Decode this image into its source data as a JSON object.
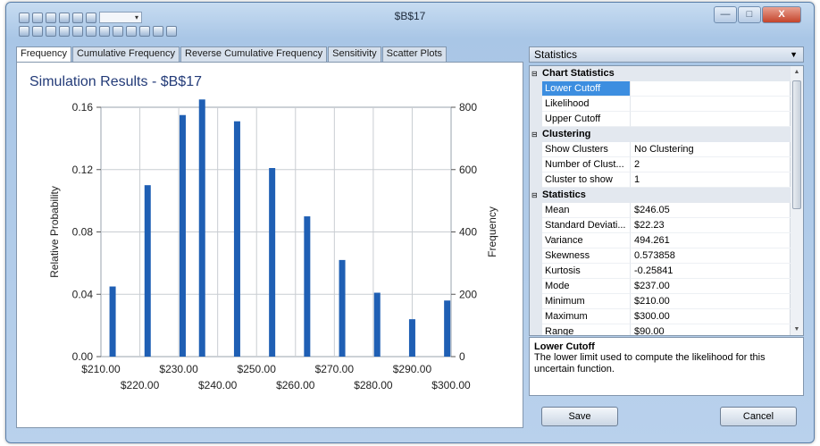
{
  "window": {
    "title": "$B$17",
    "minimize": "—",
    "maximize": "□",
    "close": "X"
  },
  "toolbar": {
    "combo_value": "▾"
  },
  "tabs": [
    "Frequency",
    "Cumulative Frequency",
    "Reverse Cumulative Frequency",
    "Sensitivity",
    "Scatter Plots"
  ],
  "chart_data": {
    "type": "bar",
    "title": "Simulation Results - $B$17",
    "ylabel": "Relative Probability",
    "y2label": "Frequency",
    "x": [
      213,
      222,
      231,
      236,
      245,
      254,
      263,
      272,
      281,
      290,
      299
    ],
    "values": [
      0.045,
      0.11,
      0.155,
      0.165,
      0.151,
      0.121,
      0.09,
      0.062,
      0.041,
      0.024,
      0.036
    ],
    "xlim": [
      210,
      300
    ],
    "ylim": [
      0,
      0.16
    ],
    "y2lim": [
      0,
      800
    ],
    "xticks_top": [
      "$210.00",
      "$230.00",
      "$250.00",
      "$270.00",
      "$290.00"
    ],
    "xticks_bottom": [
      "$220.00",
      "$240.00",
      "$260.00",
      "$280.00",
      "$300.00"
    ],
    "yticks": [
      "0.00",
      "0.04",
      "0.08",
      "0.12",
      "0.16"
    ],
    "y2ticks": [
      "0",
      "200",
      "400",
      "600",
      "800"
    ],
    "grid": true,
    "bar_color": "#1f5fb4"
  },
  "stats_panel": {
    "header": "Statistics",
    "categories": [
      {
        "label": "Chart Statistics",
        "rows": [
          {
            "name": "Lower Cutoff",
            "value": "",
            "selected": true
          },
          {
            "name": "Likelihood",
            "value": ""
          },
          {
            "name": "Upper Cutoff",
            "value": ""
          }
        ]
      },
      {
        "label": "Clustering",
        "rows": [
          {
            "name": "Show Clusters",
            "value": "No Clustering"
          },
          {
            "name": "Number of Clust...",
            "value": "2"
          },
          {
            "name": "Cluster to show",
            "value": "1"
          }
        ]
      },
      {
        "label": "Statistics",
        "rows": [
          {
            "name": "Mean",
            "value": "$246.05"
          },
          {
            "name": "Standard Deviati...",
            "value": "$22.23"
          },
          {
            "name": "Variance",
            "value": "494.261"
          },
          {
            "name": "Skewness",
            "value": "0.573858"
          },
          {
            "name": "Kurtosis",
            "value": "-0.25841"
          },
          {
            "name": "Mode",
            "value": "$237.00"
          },
          {
            "name": "Minimum",
            "value": "$210.00"
          },
          {
            "name": "Maximum",
            "value": "$300.00"
          },
          {
            "name": "Range",
            "value": "$90.00"
          }
        ]
      }
    ],
    "description_title": "Lower Cutoff",
    "description_text": "The lower limit used to compute the likelihood for this uncertain function."
  },
  "buttons": {
    "save": "Save",
    "cancel": "Cancel"
  }
}
